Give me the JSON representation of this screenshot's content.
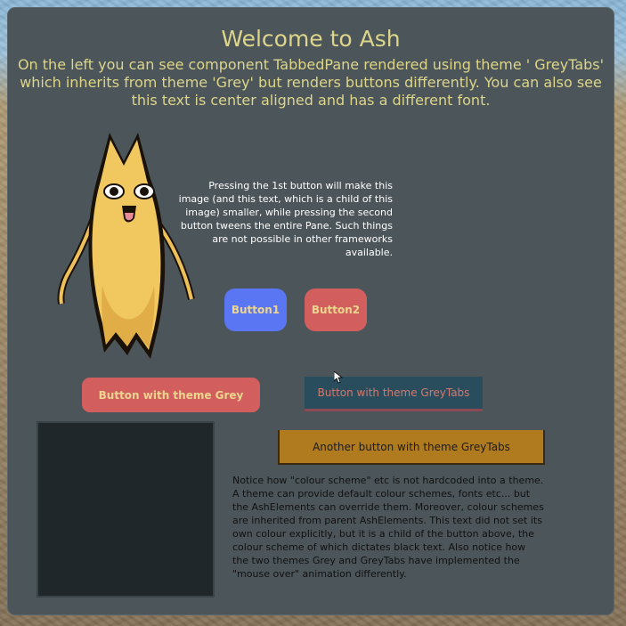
{
  "title": "Welcome to Ash",
  "intro": "On the left you can see component TabbedPane rendered using theme ' GreyTabs' which inherits from theme 'Grey' but renders buttons differently. You can also see this text is center aligned and has a different font.",
  "side_text": "Pressing the 1st button will make this image (and this text, which is a child of this image) smaller, while pressing the second button tweens the entire Pane. Such things are not possible in other frameworks available.",
  "buttons": {
    "button1": "Button1",
    "button2": "Button2",
    "grey": "Button with theme Grey",
    "greytabs": "Button with theme GreyTabs",
    "another": "Another button with theme GreyTabs"
  },
  "notice": "Notice how \"colour scheme\" etc is not hardcoded into a theme. A theme can provide default colour schemes, fonts etc... but the AshElements can override them. Moreover, colour schemes are inherited from parent AshElements. This text did not set its own colour explicitly, but it is a child of the button above, the colour scheme of which dictates black text. Also notice how the two themes Grey and GreyTabs have implemented the \"mouse over\" animation differently.",
  "colors": {
    "pane": "#4c5559",
    "title_text": "#dcd58a",
    "button1": "#5b76f2",
    "button_grey": "#d35e5e",
    "button_greytabs": "#2a4d5e",
    "button_another": "#b07a1e",
    "dark_panel": "#20272b"
  },
  "icons": {
    "character": "yellow-cat-character-image",
    "cursor": "mouse-pointer-icon"
  }
}
